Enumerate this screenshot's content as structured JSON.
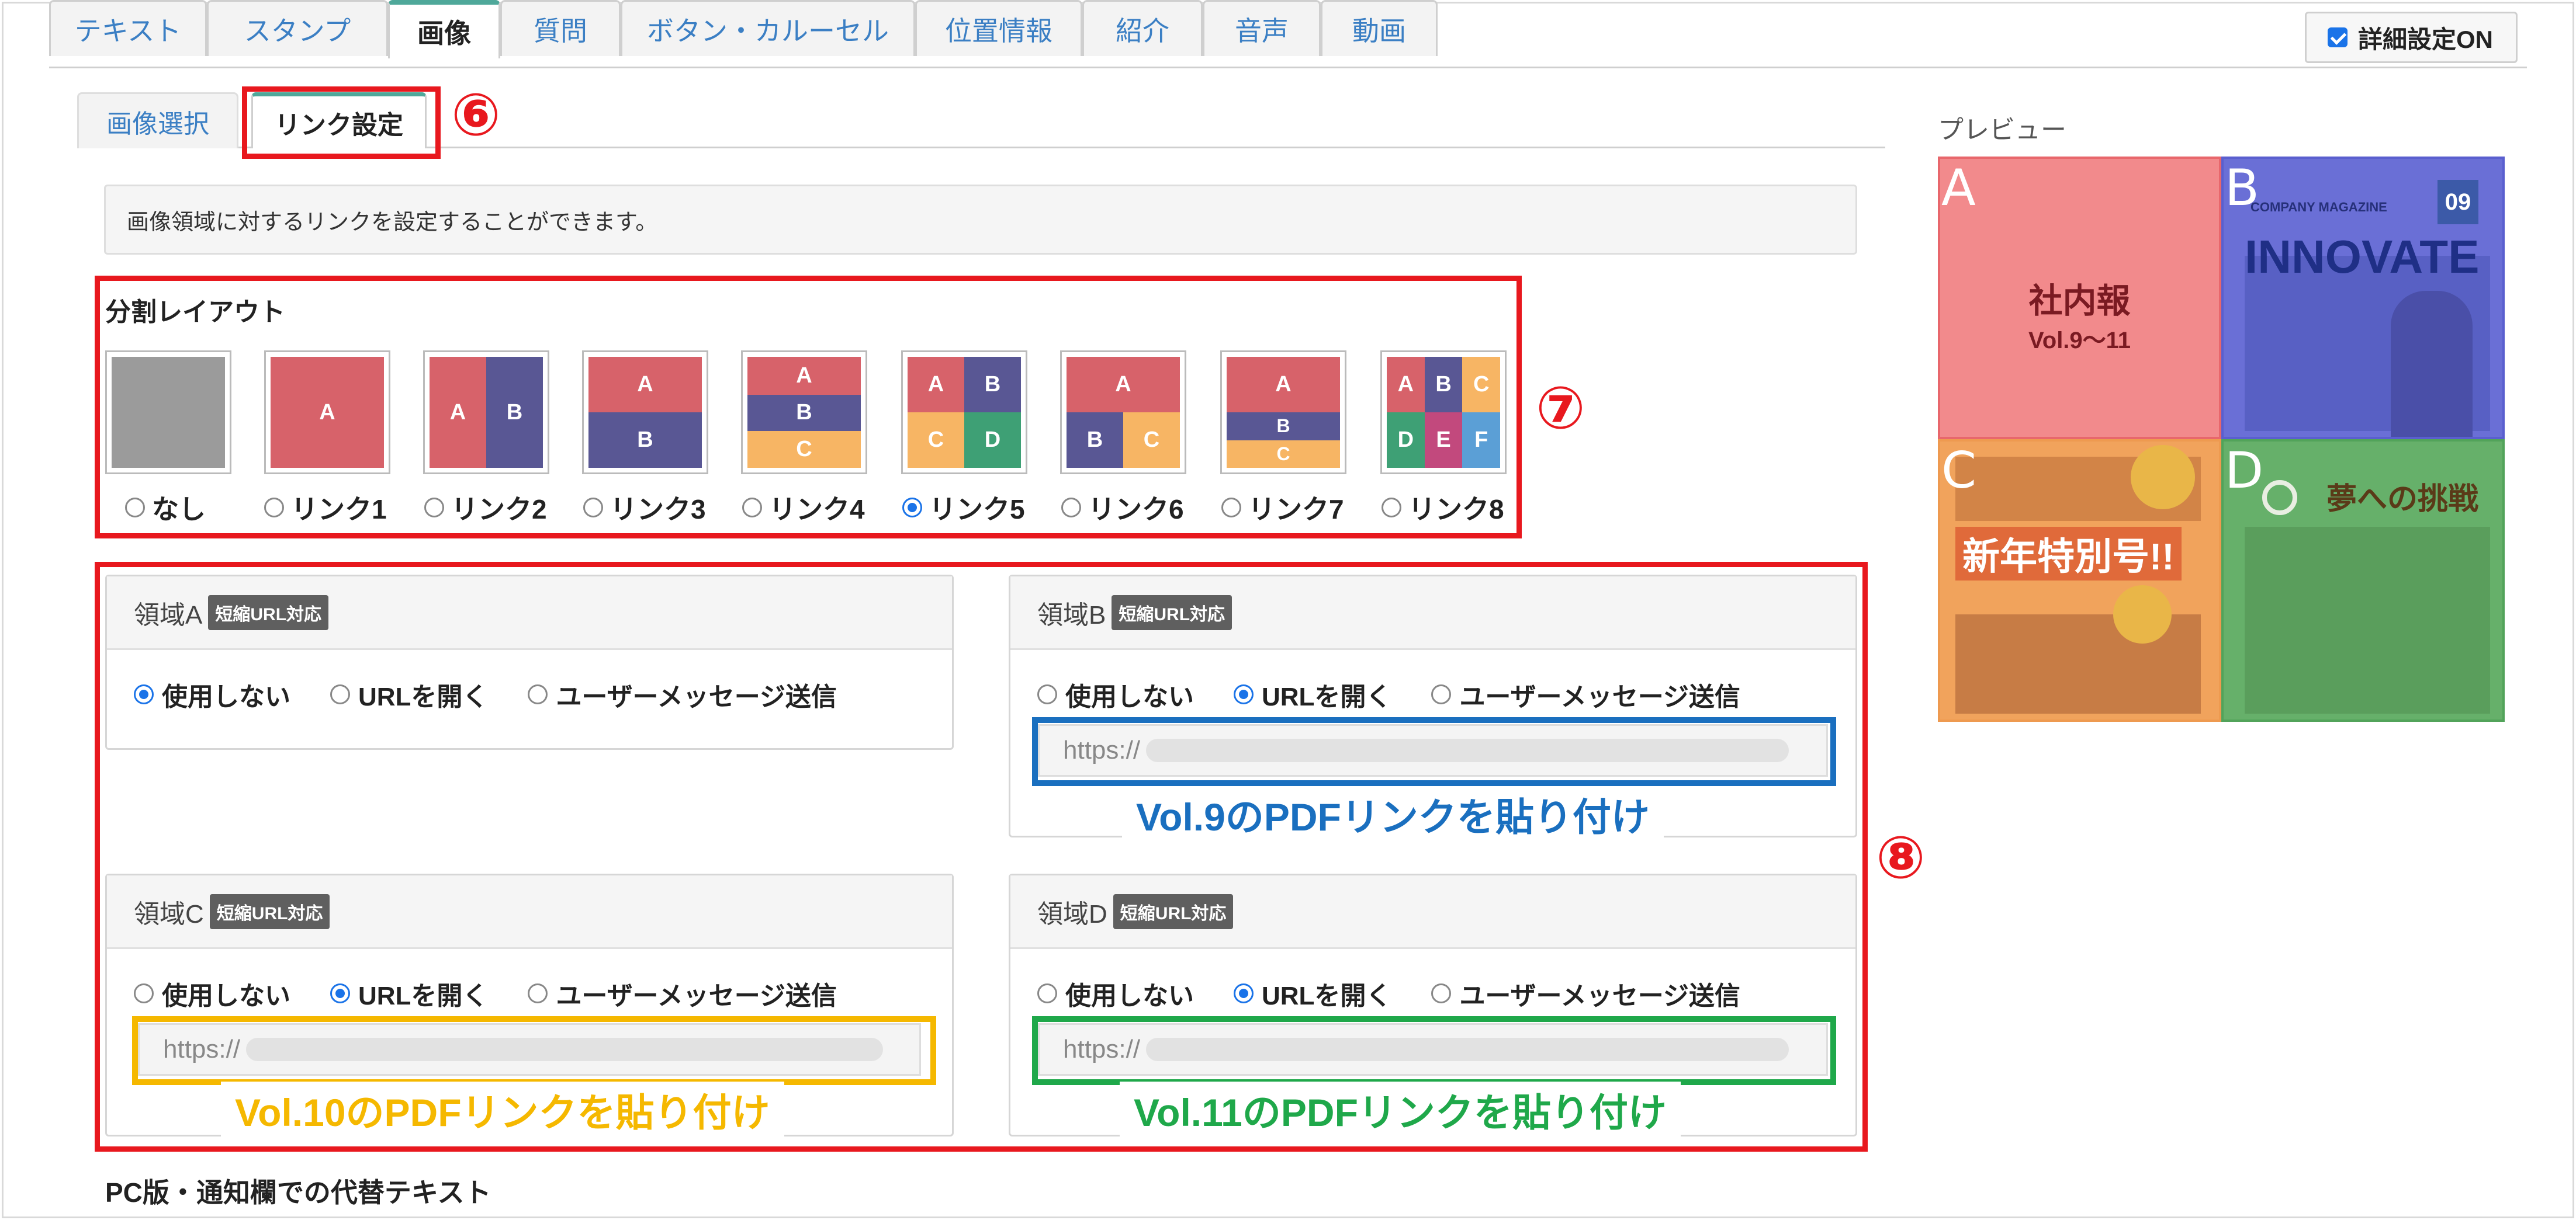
{
  "top_tabs": [
    "テキスト",
    "スタンプ",
    "画像",
    "質問",
    "ボタン・カルーセル",
    "位置情報",
    "紹介",
    "音声",
    "動画"
  ],
  "active_top_tab": "画像",
  "detail_setting": {
    "label": "詳細設定ON",
    "checked": true
  },
  "sub_tabs": {
    "image_select": "画像選択",
    "link_setting": "リンク設定"
  },
  "annotations": {
    "six": "⑥",
    "seven": "⑦",
    "eight": "⑧"
  },
  "info_text": "画像領域に対するリンクを設定することができます。",
  "layout": {
    "title": "分割レイアウト",
    "options": [
      "なし",
      "リンク1",
      "リンク2",
      "リンク3",
      "リンク4",
      "リンク5",
      "リンク6",
      "リンク7",
      "リンク8"
    ],
    "selected": "リンク5",
    "cell_letters": [
      "A",
      "B",
      "C",
      "D",
      "E",
      "F"
    ]
  },
  "regions": {
    "badge": "短縮URL対応",
    "option_labels": [
      "使用しない",
      "URLを開く",
      "ユーザーメッセージ送信"
    ],
    "A": {
      "title": "領域A",
      "selected": "使用しない"
    },
    "B": {
      "title": "領域B",
      "selected": "URLを開く",
      "url": "https://",
      "caption": "Vol.9のPDFリンクを貼り付け"
    },
    "C": {
      "title": "領域C",
      "selected": "URLを開く",
      "url": "https://",
      "caption": "Vol.10のPDFリンクを貼り付け"
    },
    "D": {
      "title": "領域D",
      "selected": "URLを開く",
      "url": "https://",
      "caption": "Vol.11のPDFリンクを貼り付け"
    }
  },
  "alt_text_title": "PC版・通知欄での代替テキスト",
  "preview": {
    "label": "プレビュー",
    "letters": [
      "A",
      "B",
      "C",
      "D"
    ],
    "a_title": "社内報",
    "a_subtitle": "Vol.9〜11",
    "b_header": "COMPANY MAGAZINE",
    "b_issue": "09",
    "b_title": "INNOVATE",
    "c_title": "新年特別号!!",
    "d_title": "夢への挑戦"
  },
  "colors": {
    "accent_red": "#e8181e",
    "caption_blue": "#1a6fbf",
    "caption_yellow": "#f5b800",
    "caption_green": "#1fa84a",
    "link_blue": "#3b7fc4"
  }
}
